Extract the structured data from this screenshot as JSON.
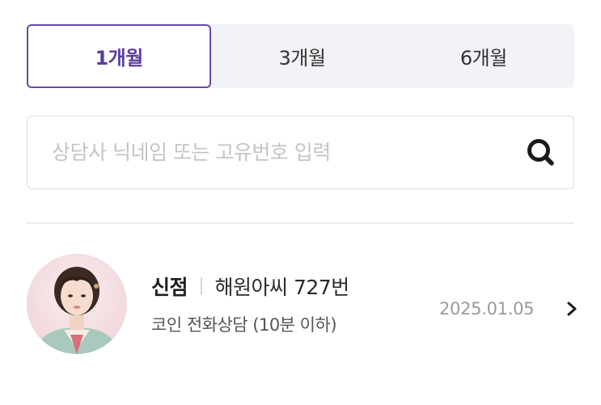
{
  "tabs": [
    {
      "label": "1개월",
      "active": true
    },
    {
      "label": "3개월",
      "active": false
    },
    {
      "label": "6개월",
      "active": false
    }
  ],
  "search": {
    "placeholder": "상담사 닉네임 또는 고유번호 입력",
    "value": "",
    "icon": "search-icon"
  },
  "history": [
    {
      "category": "신점",
      "nickname": "해원아씨 727번",
      "service": "코인 전화상담 (10분 이하)",
      "date": "2025.01.05",
      "avatar": "counselor-avatar",
      "icon": "chevron-right-icon"
    }
  ],
  "colors": {
    "accent": "#5b3b9c",
    "tab_bg": "#f2f3f6",
    "border": "#dcdde1",
    "muted": "#9a9a9e"
  }
}
